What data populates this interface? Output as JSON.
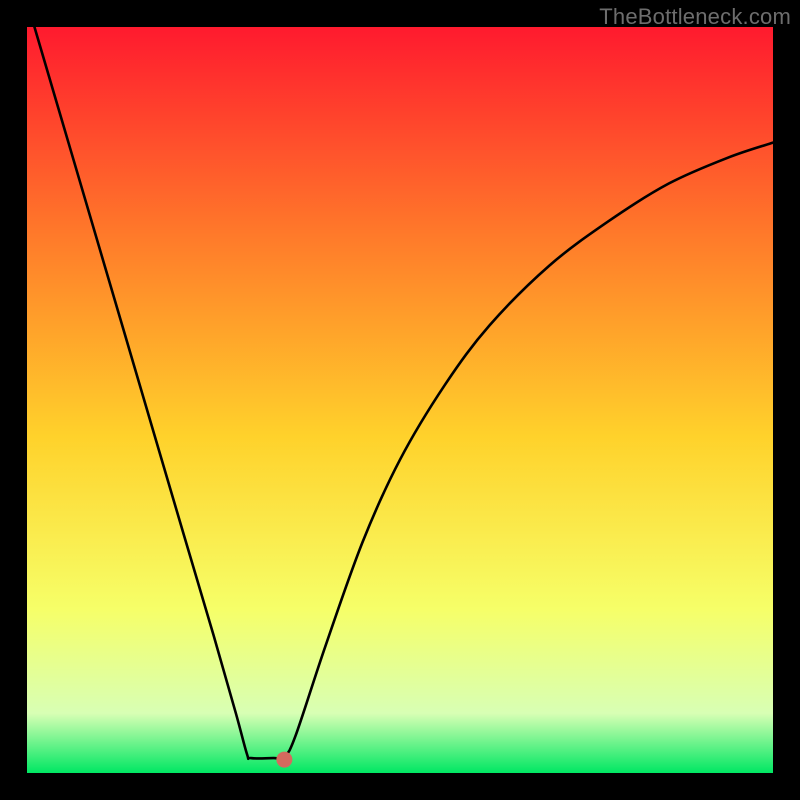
{
  "watermark": "TheBottleneck.com",
  "chart_data": {
    "type": "line",
    "title": "",
    "xlabel": "",
    "ylabel": "",
    "xlim": [
      0,
      1
    ],
    "ylim": [
      0,
      1
    ],
    "background_gradient": {
      "top": "#ff1a2e",
      "mid_upper": "#ff7a2a",
      "mid": "#ffd22b",
      "mid_lower": "#f6ff68",
      "lower": "#d8ffb4",
      "bottom": "#00e763"
    },
    "curve": [
      {
        "x": 0.01,
        "y": 1.0
      },
      {
        "x": 0.06,
        "y": 0.83
      },
      {
        "x": 0.11,
        "y": 0.66
      },
      {
        "x": 0.16,
        "y": 0.49
      },
      {
        "x": 0.21,
        "y": 0.32
      },
      {
        "x": 0.25,
        "y": 0.185
      },
      {
        "x": 0.28,
        "y": 0.08
      },
      {
        "x": 0.295,
        "y": 0.025
      },
      {
        "x": 0.3,
        "y": 0.02
      },
      {
        "x": 0.33,
        "y": 0.02
      },
      {
        "x": 0.345,
        "y": 0.022
      },
      {
        "x": 0.36,
        "y": 0.05
      },
      {
        "x": 0.4,
        "y": 0.17
      },
      {
        "x": 0.45,
        "y": 0.31
      },
      {
        "x": 0.5,
        "y": 0.42
      },
      {
        "x": 0.56,
        "y": 0.52
      },
      {
        "x": 0.62,
        "y": 0.6
      },
      {
        "x": 0.7,
        "y": 0.68
      },
      {
        "x": 0.78,
        "y": 0.74
      },
      {
        "x": 0.86,
        "y": 0.79
      },
      {
        "x": 0.94,
        "y": 0.825
      },
      {
        "x": 1.0,
        "y": 0.845
      }
    ],
    "marker": {
      "x": 0.345,
      "y": 0.018,
      "color": "#d46a5e",
      "r": 8
    }
  }
}
